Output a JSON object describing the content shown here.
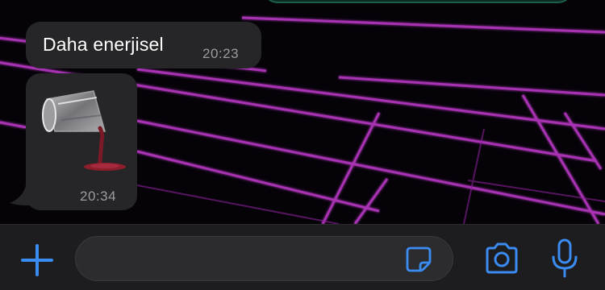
{
  "messages": [
    {
      "kind": "text",
      "text": "Daha enerjisel",
      "time": "20:23"
    },
    {
      "kind": "sticker",
      "sticker": "tipped-glass-spilling-wine",
      "time": "20:34"
    }
  ],
  "composer": {
    "value": "",
    "icons": {
      "add": "plus-icon",
      "sticker": "sticker-icon",
      "camera": "camera-icon",
      "microphone": "microphone-icon"
    }
  },
  "colors": {
    "accent": "#3a8bf2",
    "received_bubble": "#262628",
    "sent_bubble_border": "#1d5f4c",
    "grid_neon": "#c43ad0"
  }
}
